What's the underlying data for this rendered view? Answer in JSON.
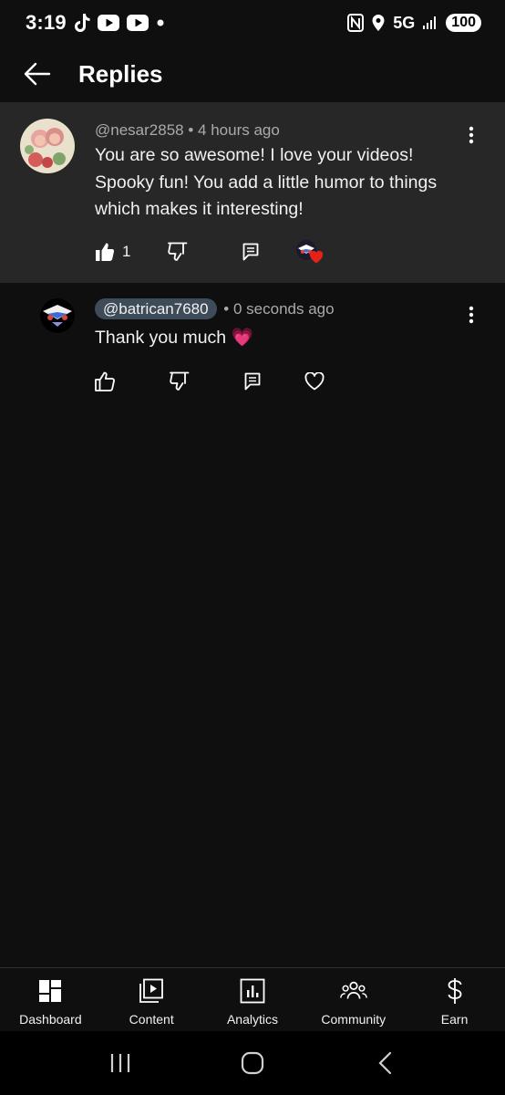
{
  "status_bar": {
    "time": "3:19",
    "network": "5G",
    "battery": "100",
    "left_icons": [
      "tiktok-icon",
      "youtube-icon",
      "youtube-icon",
      "dot-icon"
    ],
    "right_icons": [
      "nfc-icon",
      "location-icon",
      "signal-icon"
    ]
  },
  "header": {
    "title": "Replies"
  },
  "parent_comment": {
    "author": "@nesar2858",
    "time": "4 hours ago",
    "text": "You are so awesome! I love your videos! Spooky fun! You add a little humor to things which makes it interesting!",
    "like_count": "1"
  },
  "reply": {
    "author": "@batrican7680",
    "time": "0 seconds ago",
    "text": "Thank you much 💗"
  },
  "meta_separator": "•",
  "bottom_nav": {
    "items": [
      {
        "label": "Dashboard",
        "icon": "dashboard-icon"
      },
      {
        "label": "Content",
        "icon": "content-icon"
      },
      {
        "label": "Analytics",
        "icon": "analytics-icon"
      },
      {
        "label": "Community",
        "icon": "community-icon"
      },
      {
        "label": "Earn",
        "icon": "earn-icon"
      }
    ]
  },
  "colors": {
    "background": "#0f0f0f",
    "parent_highlight": "#272727",
    "handle_chip": "#3e4b59",
    "heart_red": "#e62117"
  }
}
